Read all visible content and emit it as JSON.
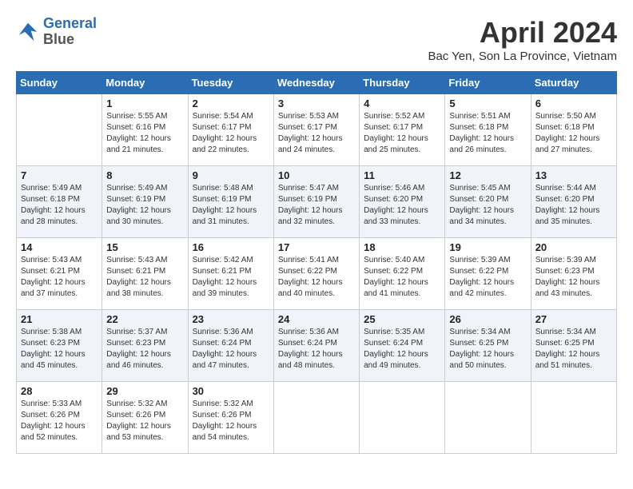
{
  "logo": {
    "line1": "General",
    "line2": "Blue"
  },
  "title": "April 2024",
  "subtitle": "Bac Yen, Son La Province, Vietnam",
  "days_header": [
    "Sunday",
    "Monday",
    "Tuesday",
    "Wednesday",
    "Thursday",
    "Friday",
    "Saturday"
  ],
  "weeks": [
    [
      {
        "num": "",
        "sunrise": "",
        "sunset": "",
        "daylight": ""
      },
      {
        "num": "1",
        "sunrise": "Sunrise: 5:55 AM",
        "sunset": "Sunset: 6:16 PM",
        "daylight": "Daylight: 12 hours and 21 minutes."
      },
      {
        "num": "2",
        "sunrise": "Sunrise: 5:54 AM",
        "sunset": "Sunset: 6:17 PM",
        "daylight": "Daylight: 12 hours and 22 minutes."
      },
      {
        "num": "3",
        "sunrise": "Sunrise: 5:53 AM",
        "sunset": "Sunset: 6:17 PM",
        "daylight": "Daylight: 12 hours and 24 minutes."
      },
      {
        "num": "4",
        "sunrise": "Sunrise: 5:52 AM",
        "sunset": "Sunset: 6:17 PM",
        "daylight": "Daylight: 12 hours and 25 minutes."
      },
      {
        "num": "5",
        "sunrise": "Sunrise: 5:51 AM",
        "sunset": "Sunset: 6:18 PM",
        "daylight": "Daylight: 12 hours and 26 minutes."
      },
      {
        "num": "6",
        "sunrise": "Sunrise: 5:50 AM",
        "sunset": "Sunset: 6:18 PM",
        "daylight": "Daylight: 12 hours and 27 minutes."
      }
    ],
    [
      {
        "num": "7",
        "sunrise": "Sunrise: 5:49 AM",
        "sunset": "Sunset: 6:18 PM",
        "daylight": "Daylight: 12 hours and 28 minutes."
      },
      {
        "num": "8",
        "sunrise": "Sunrise: 5:49 AM",
        "sunset": "Sunset: 6:19 PM",
        "daylight": "Daylight: 12 hours and 30 minutes."
      },
      {
        "num": "9",
        "sunrise": "Sunrise: 5:48 AM",
        "sunset": "Sunset: 6:19 PM",
        "daylight": "Daylight: 12 hours and 31 minutes."
      },
      {
        "num": "10",
        "sunrise": "Sunrise: 5:47 AM",
        "sunset": "Sunset: 6:19 PM",
        "daylight": "Daylight: 12 hours and 32 minutes."
      },
      {
        "num": "11",
        "sunrise": "Sunrise: 5:46 AM",
        "sunset": "Sunset: 6:20 PM",
        "daylight": "Daylight: 12 hours and 33 minutes."
      },
      {
        "num": "12",
        "sunrise": "Sunrise: 5:45 AM",
        "sunset": "Sunset: 6:20 PM",
        "daylight": "Daylight: 12 hours and 34 minutes."
      },
      {
        "num": "13",
        "sunrise": "Sunrise: 5:44 AM",
        "sunset": "Sunset: 6:20 PM",
        "daylight": "Daylight: 12 hours and 35 minutes."
      }
    ],
    [
      {
        "num": "14",
        "sunrise": "Sunrise: 5:43 AM",
        "sunset": "Sunset: 6:21 PM",
        "daylight": "Daylight: 12 hours and 37 minutes."
      },
      {
        "num": "15",
        "sunrise": "Sunrise: 5:43 AM",
        "sunset": "Sunset: 6:21 PM",
        "daylight": "Daylight: 12 hours and 38 minutes."
      },
      {
        "num": "16",
        "sunrise": "Sunrise: 5:42 AM",
        "sunset": "Sunset: 6:21 PM",
        "daylight": "Daylight: 12 hours and 39 minutes."
      },
      {
        "num": "17",
        "sunrise": "Sunrise: 5:41 AM",
        "sunset": "Sunset: 6:22 PM",
        "daylight": "Daylight: 12 hours and 40 minutes."
      },
      {
        "num": "18",
        "sunrise": "Sunrise: 5:40 AM",
        "sunset": "Sunset: 6:22 PM",
        "daylight": "Daylight: 12 hours and 41 minutes."
      },
      {
        "num": "19",
        "sunrise": "Sunrise: 5:39 AM",
        "sunset": "Sunset: 6:22 PM",
        "daylight": "Daylight: 12 hours and 42 minutes."
      },
      {
        "num": "20",
        "sunrise": "Sunrise: 5:39 AM",
        "sunset": "Sunset: 6:23 PM",
        "daylight": "Daylight: 12 hours and 43 minutes."
      }
    ],
    [
      {
        "num": "21",
        "sunrise": "Sunrise: 5:38 AM",
        "sunset": "Sunset: 6:23 PM",
        "daylight": "Daylight: 12 hours and 45 minutes."
      },
      {
        "num": "22",
        "sunrise": "Sunrise: 5:37 AM",
        "sunset": "Sunset: 6:23 PM",
        "daylight": "Daylight: 12 hours and 46 minutes."
      },
      {
        "num": "23",
        "sunrise": "Sunrise: 5:36 AM",
        "sunset": "Sunset: 6:24 PM",
        "daylight": "Daylight: 12 hours and 47 minutes."
      },
      {
        "num": "24",
        "sunrise": "Sunrise: 5:36 AM",
        "sunset": "Sunset: 6:24 PM",
        "daylight": "Daylight: 12 hours and 48 minutes."
      },
      {
        "num": "25",
        "sunrise": "Sunrise: 5:35 AM",
        "sunset": "Sunset: 6:24 PM",
        "daylight": "Daylight: 12 hours and 49 minutes."
      },
      {
        "num": "26",
        "sunrise": "Sunrise: 5:34 AM",
        "sunset": "Sunset: 6:25 PM",
        "daylight": "Daylight: 12 hours and 50 minutes."
      },
      {
        "num": "27",
        "sunrise": "Sunrise: 5:34 AM",
        "sunset": "Sunset: 6:25 PM",
        "daylight": "Daylight: 12 hours and 51 minutes."
      }
    ],
    [
      {
        "num": "28",
        "sunrise": "Sunrise: 5:33 AM",
        "sunset": "Sunset: 6:26 PM",
        "daylight": "Daylight: 12 hours and 52 minutes."
      },
      {
        "num": "29",
        "sunrise": "Sunrise: 5:32 AM",
        "sunset": "Sunset: 6:26 PM",
        "daylight": "Daylight: 12 hours and 53 minutes."
      },
      {
        "num": "30",
        "sunrise": "Sunrise: 5:32 AM",
        "sunset": "Sunset: 6:26 PM",
        "daylight": "Daylight: 12 hours and 54 minutes."
      },
      {
        "num": "",
        "sunrise": "",
        "sunset": "",
        "daylight": ""
      },
      {
        "num": "",
        "sunrise": "",
        "sunset": "",
        "daylight": ""
      },
      {
        "num": "",
        "sunrise": "",
        "sunset": "",
        "daylight": ""
      },
      {
        "num": "",
        "sunrise": "",
        "sunset": "",
        "daylight": ""
      }
    ]
  ]
}
